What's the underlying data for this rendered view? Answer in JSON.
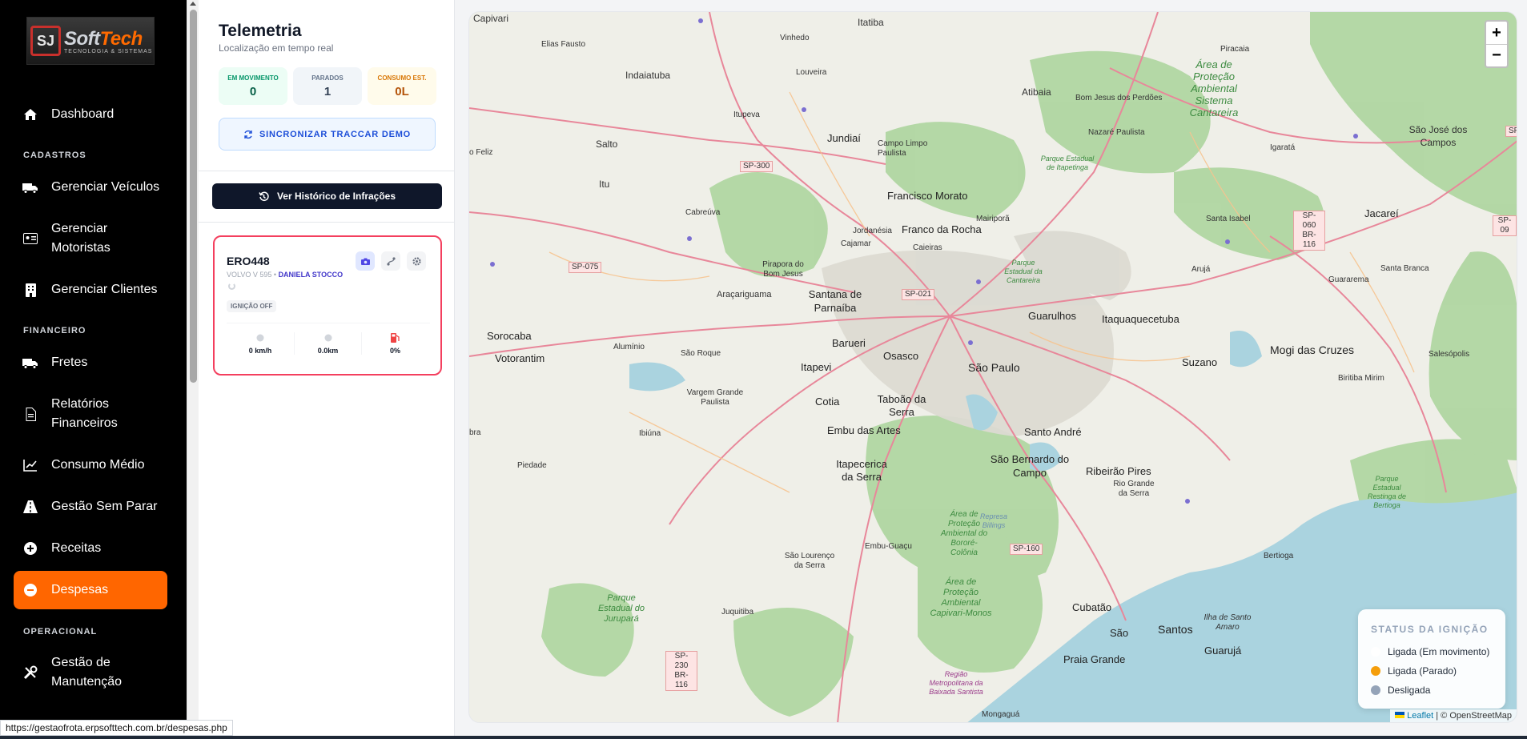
{
  "brand": {
    "name_a": "Soft",
    "name_b": "Tech",
    "tagline": "TECNOLOGIA & SISTEMAS"
  },
  "sidebar": {
    "dashboard": "Dashboard",
    "section_cadastros": "CADASTROS",
    "veiculos": "Gerenciar Veículos",
    "motoristas_1": "Gerenciar",
    "motoristas_2": "Motoristas",
    "clientes": "Gerenciar Clientes",
    "section_financeiro": "FINANCEIRO",
    "fretes": "Fretes",
    "relatorios_1": "Relatórios",
    "relatorios_2": "Financeiros",
    "consumo": "Consumo Médio",
    "sem_parar": "Gestão Sem Parar",
    "receitas": "Receitas",
    "despesas": "Despesas",
    "section_operacional": "OPERACIONAL",
    "manutencao_1": "Gestão de",
    "manutencao_2": "Manutenção"
  },
  "panel": {
    "title": "Telemetria",
    "subtitle": "Localização em tempo real",
    "stats": [
      {
        "label": "EM MOVIMENTO",
        "value": "0"
      },
      {
        "label": "PARADOS",
        "value": "1"
      },
      {
        "label": "CONSUMO EST.",
        "value": "0L"
      }
    ],
    "sync_label": "SINCRONIZAR TRACCAR DEMO",
    "history_label": "Ver Histórico de Infrações",
    "vehicle": {
      "plate": "ERO448",
      "model": "VOLVO V 595",
      "separator": "•",
      "driver": "DANIELA STOCCO",
      "ignition": "IGNIÇÃO OFF",
      "speed": "0 km/h",
      "distance": "0.0km",
      "fuel": "0%"
    }
  },
  "map": {
    "zoom_in": "+",
    "zoom_out": "−",
    "legend": {
      "title": "STATUS DA IGNIÇÃO",
      "items": [
        {
          "label": "Ligada (Em movimento)",
          "color": "#ffffff"
        },
        {
          "label": "Ligada (Parado)",
          "color": "#f59e0b"
        },
        {
          "label": "Desligada",
          "color": "#94a3b8"
        }
      ]
    },
    "attribution_link": "Leaflet",
    "attribution_text": "| © OpenStreetMap",
    "places": {
      "capivari": "Capivari",
      "itatiba": "Itatiba",
      "vinhedo": "Vinhedo",
      "elias": "Elias Fausto",
      "indaiatuba": "Indaiatuba",
      "louveira": "Louveira",
      "atibaia": "Atibaia",
      "bomjesus": "Bom Jesus dos Perdões",
      "piracaia": "Piracaia",
      "cantareira": "Área de Proteção Ambiental Sistema Cantareira",
      "itupeva": "Itupeva",
      "jundiai": "Jundiaí",
      "nazare": "Nazaré Paulista",
      "sjcampos": "São José dos Campos",
      "salto": "Salto",
      "campolimpo": "Campo Limpo Paulista",
      "igarata": "Igaratá",
      "itapetinga": "Parque Estadual de Itapetinga",
      "itu": "Itu",
      "francisco": "Francisco Morato",
      "cabreuva": "Cabreúva",
      "mairipora": "Mairiporã",
      "santaisabel": "Santa Isabel",
      "jacarei": "Jacareí",
      "jordanesia": "Jordanésia",
      "francodarocha": "Franco da Rocha",
      "cajamar": "Cajamar",
      "caieiras": "Caieiras",
      "pirapora": "Pirapora do Bom Jesus",
      "arujá": "Arujá",
      "santabranca": "Santa Branca",
      "guararema": "Guararema",
      "pecantareira": "Parque Estadual da Cantareira",
      "aracariguama": "Araçariguama",
      "santana": "Santana de Parnaíba",
      "guarulhos": "Guarulhos",
      "itaqua": "Itaquaquecetuba",
      "sorocaba": "Sorocaba",
      "aluminio": "Alumínio",
      "barueri": "Barueri",
      "mogi": "Mogi das Cruzes",
      "salesopolis": "Salesópolis",
      "votorantim": "Votorantim",
      "saoroque": "São Roque",
      "osasco": "Osasco",
      "saopaulo": "São Paulo",
      "suzano": "Suzano",
      "itapevi": "Itapevi",
      "biritiba": "Biritiba Mirim",
      "vargem": "Vargem Grande Paulista",
      "cotia": "Cotia",
      "taboao": "Taboão da Serra",
      "embu": "Embu das Artes",
      "ibiuna": "Ibiúna",
      "santoandre": "Santo André",
      "piedade": "Piedade",
      "itapecerica": "Itapecerica da Serra",
      "sbc": "São Bernardo do Campo",
      "ribeirao": "Ribeirão Pires",
      "riogrande": "Rio Grande da Serra",
      "bertioga_pe": "Parque Estadual Restinga de Bertioga",
      "apa_bororé": "Área de Proteção Ambiental do Bororé-Colônia",
      "billings": "Represa Billings",
      "embuguacu": "Embu-Guaçu",
      "saolourenco": "São Lourenço da Serra",
      "bertioga": "Bertioga",
      "jurupara": "Parque Estadual do Jurupará",
      "juquitiba": "Juquitiba",
      "capivari_monos": "Área de Proteção Ambiental Capivari-Monos",
      "cubatao": "Cubatão",
      "santoamaro": "Ilha de Santo Amaro",
      "sac": "São",
      "santos": "Santos",
      "guaruja": "Guarujá",
      "praiagrande": "Praia Grande",
      "baixada": "Região Metropolitana da Baixada Santista",
      "mongagua": "Mongaguá",
      "piedade_feliz": "o Feliz",
      "bra": "bra"
    },
    "roads": {
      "sp300": "SP-300",
      "sp075": "SP-075",
      "sp021": "SP-021",
      "sp060": "SP-060 BR-116",
      "sp160": "SP-160",
      "sp230": "SP-230 BR-116",
      "sp09": "SP-09",
      "sp_edge": "SP"
    }
  },
  "status_url": "https://gestaofrota.erpsofttech.com.br/despesas.php"
}
